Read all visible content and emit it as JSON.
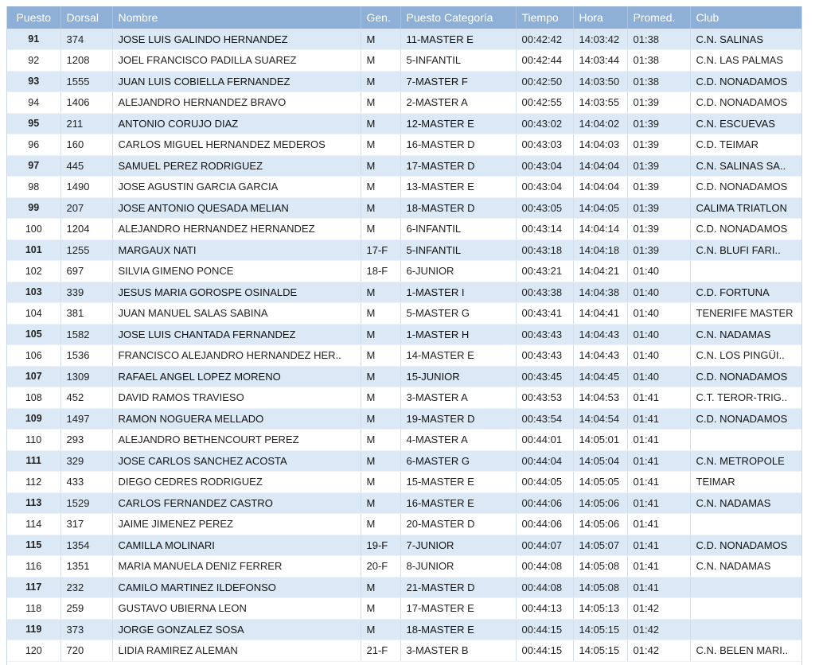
{
  "table": {
    "headers": [
      "Puesto",
      "Dorsal",
      "Nombre",
      "Gen.",
      "Puesto Categoría",
      "Tiempo",
      "Hora",
      "Promed.",
      "Club"
    ],
    "rows": [
      [
        "91",
        "374",
        "JOSE LUIS GALINDO HERNANDEZ",
        "M",
        "11-MASTER E",
        "00:42:42",
        "14:03:42",
        "01:38",
        "C.N. SALINAS"
      ],
      [
        "92",
        "1208",
        "JOEL FRANCISCO PADILLA SUAREZ",
        "M",
        "5-INFANTIL",
        "00:42:44",
        "14:03:44",
        "01:38",
        "C.N. LAS PALMAS"
      ],
      [
        "93",
        "1555",
        "JUAN LUIS COBIELLA FERNANDEZ",
        "M",
        "7-MASTER F",
        "00:42:50",
        "14:03:50",
        "01:38",
        "C.D. NONADAMOS"
      ],
      [
        "94",
        "1406",
        "ALEJANDRO HERNANDEZ BRAVO",
        "M",
        "2-MASTER A",
        "00:42:55",
        "14:03:55",
        "01:39",
        "C.D. NONADAMOS"
      ],
      [
        "95",
        "211",
        "ANTONIO CORUJO DIAZ",
        "M",
        "12-MASTER E",
        "00:43:02",
        "14:04:02",
        "01:39",
        "C.N. ESCUEVAS"
      ],
      [
        "96",
        "160",
        "CARLOS MIGUEL HERNANDEZ MEDEROS",
        "M",
        "16-MASTER D",
        "00:43:03",
        "14:04:03",
        "01:39",
        "C.D. TEIMAR"
      ],
      [
        "97",
        "445",
        "SAMUEL PEREZ RODRIGUEZ",
        "M",
        "17-MASTER D",
        "00:43:04",
        "14:04:04",
        "01:39",
        "C.N. SALINAS SA.."
      ],
      [
        "98",
        "1490",
        "JOSE AGUSTIN GARCIA GARCIA",
        "M",
        "13-MASTER E",
        "00:43:04",
        "14:04:04",
        "01:39",
        "C.D. NONADAMOS"
      ],
      [
        "99",
        "207",
        "JOSE ANTONIO QUESADA MELIAN",
        "M",
        "18-MASTER D",
        "00:43:05",
        "14:04:05",
        "01:39",
        "CALIMA TRIATLON"
      ],
      [
        "100",
        "1204",
        "ALEJANDRO HERNANDEZ HERNANDEZ",
        "M",
        "6-INFANTIL",
        "00:43:14",
        "14:04:14",
        "01:39",
        "C.D. NONADAMOS"
      ],
      [
        "101",
        "1255",
        "MARGAUX NATI",
        "17-F",
        "5-INFANTIL",
        "00:43:18",
        "14:04:18",
        "01:39",
        "C.N. BLUFI FARI.."
      ],
      [
        "102",
        "697",
        "SILVIA GIMENO PONCE",
        "18-F",
        "6-JUNIOR",
        "00:43:21",
        "14:04:21",
        "01:40",
        ""
      ],
      [
        "103",
        "339",
        "JESUS MARIA GOROSPE OSINALDE",
        "M",
        "1-MASTER I",
        "00:43:38",
        "14:04:38",
        "01:40",
        "C.D. FORTUNA"
      ],
      [
        "104",
        "381",
        "JUAN MANUEL SALAS SABINA",
        "M",
        "5-MASTER G",
        "00:43:41",
        "14:04:41",
        "01:40",
        "TENERIFE MASTER"
      ],
      [
        "105",
        "1582",
        "JOSE LUIS CHANTADA FERNANDEZ",
        "M",
        "1-MASTER H",
        "00:43:43",
        "14:04:43",
        "01:40",
        "C.N. NADAMAS"
      ],
      [
        "106",
        "1536",
        "FRANCISCO ALEJANDRO HERNANDEZ HER..",
        "M",
        "14-MASTER E",
        "00:43:43",
        "14:04:43",
        "01:40",
        "C.N. LOS PINGÜI.."
      ],
      [
        "107",
        "1309",
        "RAFAEL ANGEL LOPEZ MORENO",
        "M",
        "15-JUNIOR",
        "00:43:45",
        "14:04:45",
        "01:40",
        "C.D. NONADAMOS"
      ],
      [
        "108",
        "452",
        "DAVID RAMOS TRAVIESO",
        "M",
        "3-MASTER A",
        "00:43:53",
        "14:04:53",
        "01:41",
        "C.T. TEROR-TRIG.."
      ],
      [
        "109",
        "1497",
        "RAMON NOGUERA MELLADO",
        "M",
        "19-MASTER D",
        "00:43:54",
        "14:04:54",
        "01:41",
        "C.D. NONADAMOS"
      ],
      [
        "110",
        "293",
        "ALEJANDRO BETHENCOURT PEREZ",
        "M",
        "4-MASTER A",
        "00:44:01",
        "14:05:01",
        "01:41",
        ""
      ],
      [
        "111",
        "329",
        "JOSE CARLOS SANCHEZ ACOSTA",
        "M",
        "6-MASTER G",
        "00:44:04",
        "14:05:04",
        "01:41",
        "C.N. METROPOLE"
      ],
      [
        "112",
        "433",
        "DIEGO CEDRES RODRIGUEZ",
        "M",
        "15-MASTER E",
        "00:44:05",
        "14:05:05",
        "01:41",
        "TEIMAR"
      ],
      [
        "113",
        "1529",
        "CARLOS FERNANDEZ CASTRO",
        "M",
        "16-MASTER E",
        "00:44:06",
        "14:05:06",
        "01:41",
        "C.N. NADAMAS"
      ],
      [
        "114",
        "317",
        "JAIME JIMENEZ PEREZ",
        "M",
        "20-MASTER D",
        "00:44:06",
        "14:05:06",
        "01:41",
        ""
      ],
      [
        "115",
        "1354",
        "CAMILLA MOLINARI",
        "19-F",
        "7-JUNIOR",
        "00:44:07",
        "14:05:07",
        "01:41",
        "C.D. NONADAMOS"
      ],
      [
        "116",
        "1351",
        "MARIA MANUELA DENIZ FERRER",
        "20-F",
        "8-JUNIOR",
        "00:44:08",
        "14:05:08",
        "01:41",
        "C.N. NADAMAS"
      ],
      [
        "117",
        "232",
        "CAMILO MARTINEZ ILDEFONSO",
        "M",
        "21-MASTER D",
        "00:44:08",
        "14:05:08",
        "01:41",
        ""
      ],
      [
        "118",
        "259",
        "GUSTAVO UBIERNA LEON",
        "M",
        "17-MASTER E",
        "00:44:13",
        "14:05:13",
        "01:42",
        ""
      ],
      [
        "119",
        "373",
        "JORGE GONZALEZ SOSA",
        "M",
        "18-MASTER E",
        "00:44:15",
        "14:05:15",
        "01:42",
        ""
      ],
      [
        "120",
        "720",
        "LIDIA RAMIREZ ALEMAN",
        "21-F",
        "3-MASTER B",
        "00:44:15",
        "14:05:15",
        "01:42",
        "C.N. BELEN MARI.."
      ]
    ]
  },
  "colors": {
    "header_bg": "#8fb0d6",
    "row_alt_bg": "#dbe8f5",
    "row_bg": "#ffffff"
  }
}
